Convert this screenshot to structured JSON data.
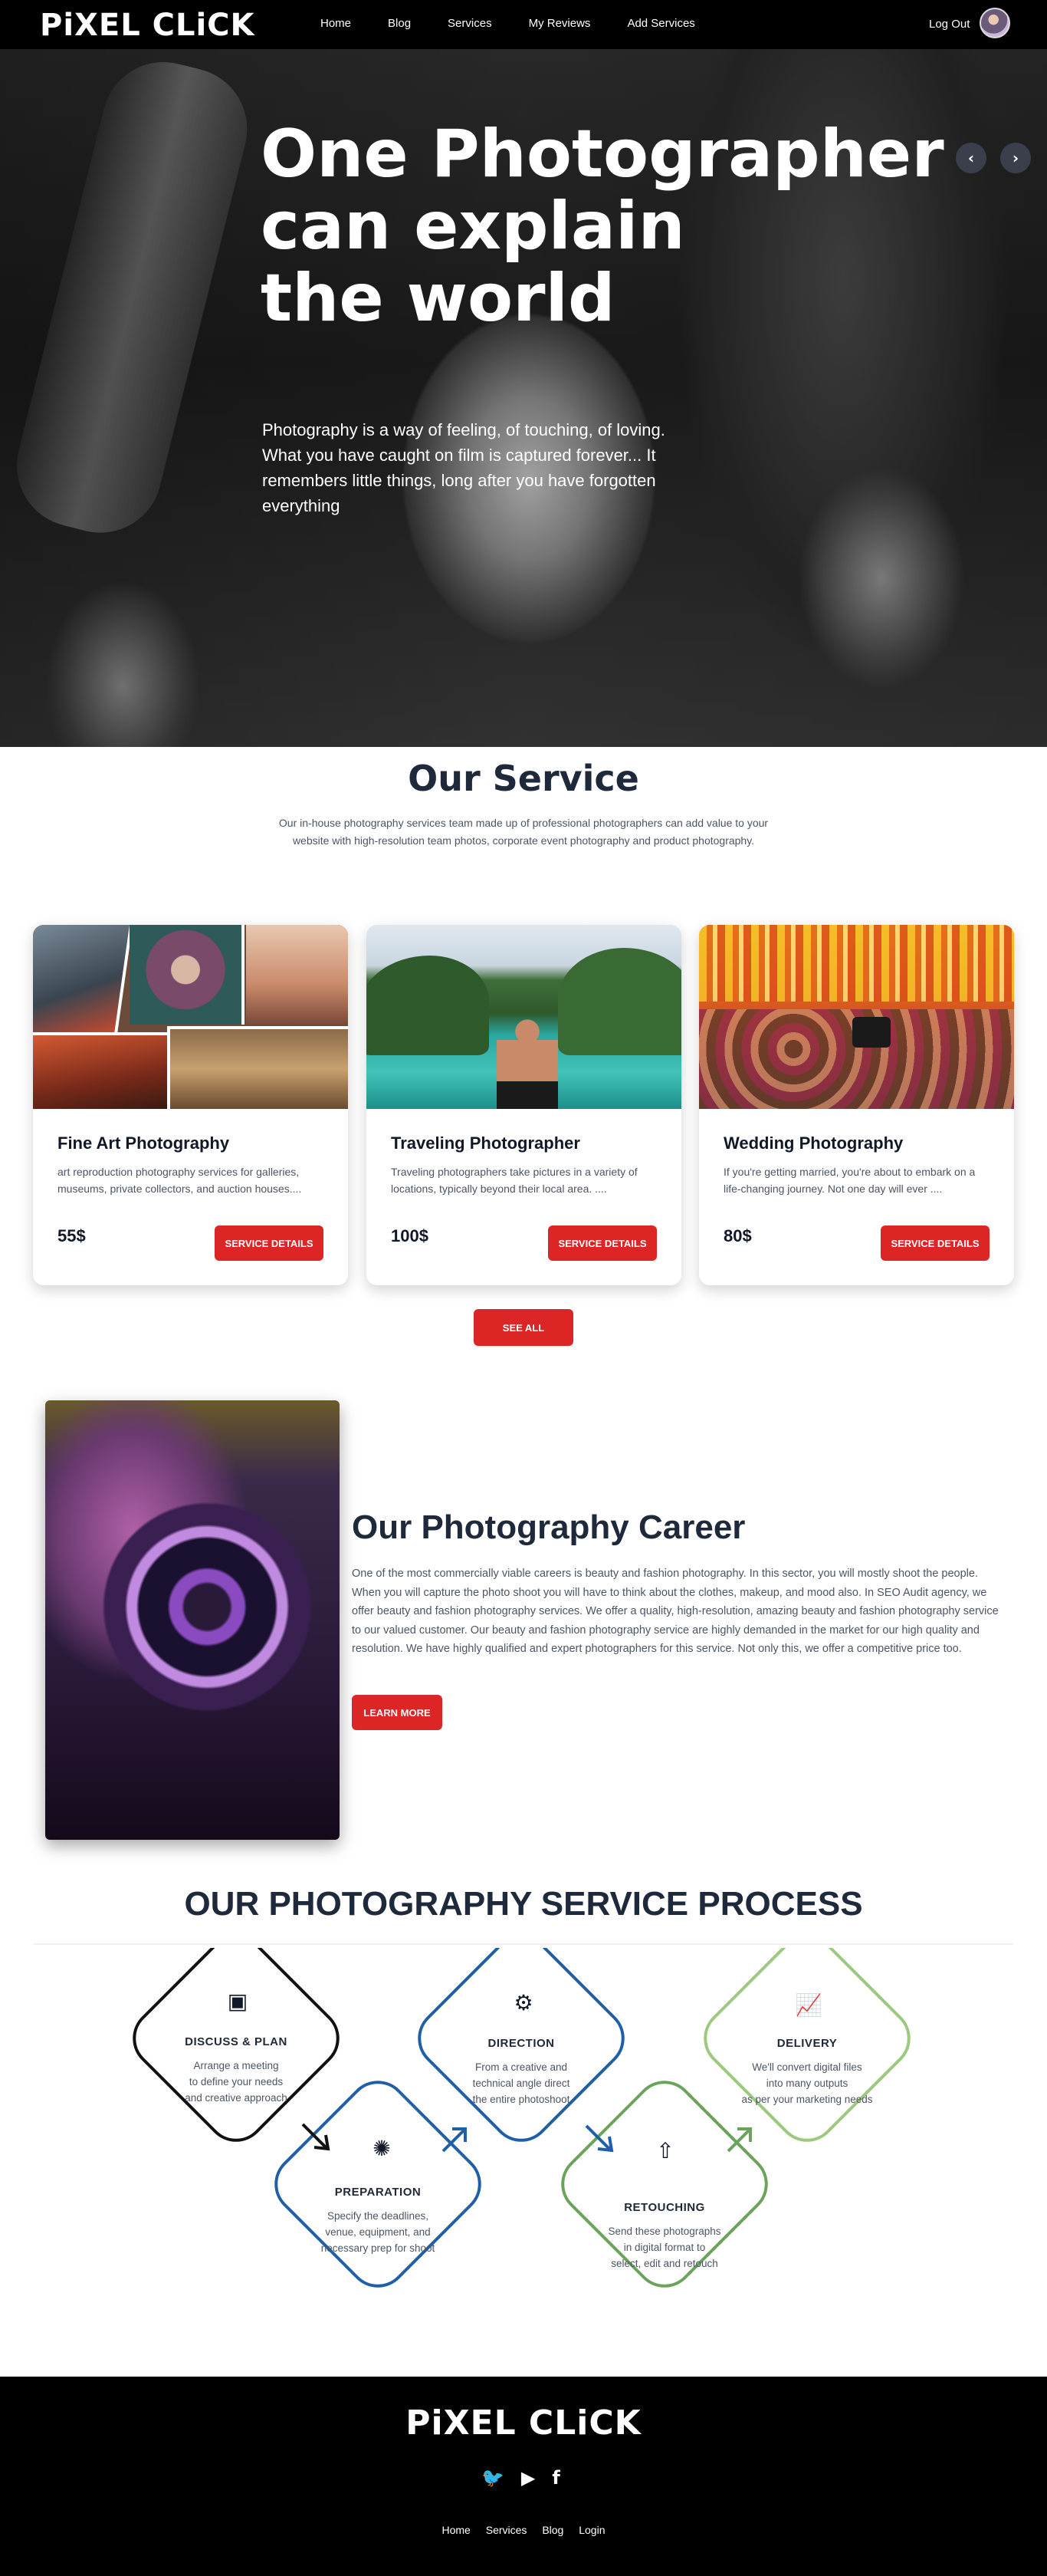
{
  "brand": "PiXEL CLiCK",
  "nav": {
    "links": [
      "Home",
      "Blog",
      "Services",
      "My Reviews",
      "Add Services"
    ],
    "logout": "Log Out"
  },
  "hero": {
    "title": "One Photographer\ncan explain\nthe world",
    "text": "Photography is a way of feeling, of touching, of loving. What you have caught on film is captured forever... It remembers little things, long after you have forgotten everything",
    "prev_icon": "‹",
    "next_icon": "›"
  },
  "service": {
    "title": "Our Service",
    "subtitle": "Our in-house photography services team made up of professional photographers can add value to your website with high-resolution team photos, corporate event photography and product photography.",
    "cards": [
      {
        "title": "Fine Art Photography",
        "desc": "art reproduction photography services for galleries, museums, private collectors, and auction houses....",
        "price": "55$",
        "button": "SERVICE DETAILS"
      },
      {
        "title": "Traveling Photographer",
        "desc": "Traveling photographers take pictures in a variety of locations, typically beyond their local area. ....",
        "price": "100$",
        "button": "SERVICE DETAILS"
      },
      {
        "title": "Wedding Photography",
        "desc": "If you're getting married, you're about to embark on a life-changing journey. Not one day will ever ....",
        "price": "80$",
        "button": "SERVICE DETAILS"
      }
    ],
    "see_all": "SEE ALL"
  },
  "career": {
    "title": "Our Photography Career",
    "text": "One of the most commercially viable careers is beauty and fashion photography. In this sector, you will mostly shoot the people. When you will capture the photo shoot you will have to think about the clothes, makeup, and mood also. In SEO Audit agency, we offer beauty and fashion photography services. We offer a quality, high-resolution, amazing beauty and fashion photography service to our valued customer. Our beauty and fashion photography service are highly demanded in the market for our high quality and resolution. We have highly qualified and expert photographers for this service. Not only this, we offer a competitive price too.",
    "button": "LEARN MORE"
  },
  "process": {
    "title": "OUR PHOTOGRAPHY SERVICE PROCESS",
    "steps": [
      {
        "title": "DISCUSS & PLAN",
        "desc": "Arrange a meeting\nto define your needs\nand creative approach",
        "icon": "presentation-icon",
        "glyph": "▣"
      },
      {
        "title": "PREPARATION",
        "desc": "Specify the deadlines,\nvenue, equipment, and\nnecessary prep for shoot",
        "icon": "lightbulb-icon",
        "glyph": "✺"
      },
      {
        "title": "DIRECTION",
        "desc": "From a creative and\ntechnical angle direct\nthe entire photoshoot",
        "icon": "brain-gear-icon",
        "glyph": "⚙"
      },
      {
        "title": "RETOUCHING",
        "desc": "Send these photographs\nin digital format to\nselect, edit and retouch",
        "icon": "rocket-icon",
        "glyph": "⇧"
      },
      {
        "title": "DELIVERY",
        "desc": "We'll convert digital files\ninto many outputs\nas per your marketing needs",
        "icon": "growth-chart-icon",
        "glyph": "📈"
      }
    ],
    "colors": {
      "black": "#111111",
      "blue": "#1f5fa8",
      "green": "#6aa35a",
      "light_green": "#9cc97e"
    }
  },
  "footer": {
    "social": [
      "twitter-icon",
      "youtube-icon",
      "facebook-icon"
    ],
    "social_glyphs": [
      "🐦",
      "▶",
      "f"
    ],
    "links": [
      "Home",
      "Services",
      "Blog",
      "Login"
    ]
  },
  "colors": {
    "accent": "#dc2626",
    "dark": "#000000",
    "heading": "#1e293b"
  }
}
